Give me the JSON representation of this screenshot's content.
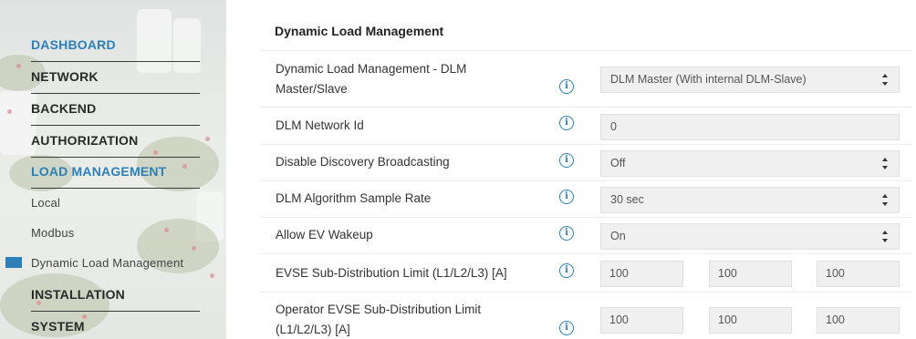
{
  "sidebar": {
    "items": [
      {
        "label": "DASHBOARD"
      },
      {
        "label": "NETWORK"
      },
      {
        "label": "BACKEND"
      },
      {
        "label": "AUTHORIZATION"
      },
      {
        "label": "LOAD MANAGEMENT"
      },
      {
        "label": "Local"
      },
      {
        "label": "Modbus"
      },
      {
        "label": "Dynamic Load Management"
      },
      {
        "label": "INSTALLATION"
      },
      {
        "label": "SYSTEM"
      }
    ],
    "accent_color": "#2e7fb8"
  },
  "main": {
    "section_title": "Dynamic Load Management",
    "info_icon_glyph": "i",
    "fields": {
      "dlm_mode": {
        "label_line1": "Dynamic Load Management - DLM",
        "label_line2": "Master/Slave",
        "value": "DLM Master (With internal DLM-Slave)"
      },
      "network_id": {
        "label": "DLM Network Id",
        "value": "0"
      },
      "discovery": {
        "label": "Disable Discovery Broadcasting",
        "value": "Off"
      },
      "sample_rate": {
        "label": "DLM Algorithm Sample Rate",
        "value": "30 sec"
      },
      "ev_wakeup": {
        "label": "Allow EV Wakeup",
        "value": "On"
      },
      "evse_limit": {
        "label": "EVSE Sub-Distribution Limit (L1/L2/L3) [A]",
        "l1": "100",
        "l2": "100",
        "l3": "100"
      },
      "operator_limit": {
        "label_line1": "Operator EVSE Sub-Distribution Limit",
        "label_line2": "(L1/L2/L3) [A]",
        "l1": "100",
        "l2": "100",
        "l3": "100"
      }
    }
  }
}
